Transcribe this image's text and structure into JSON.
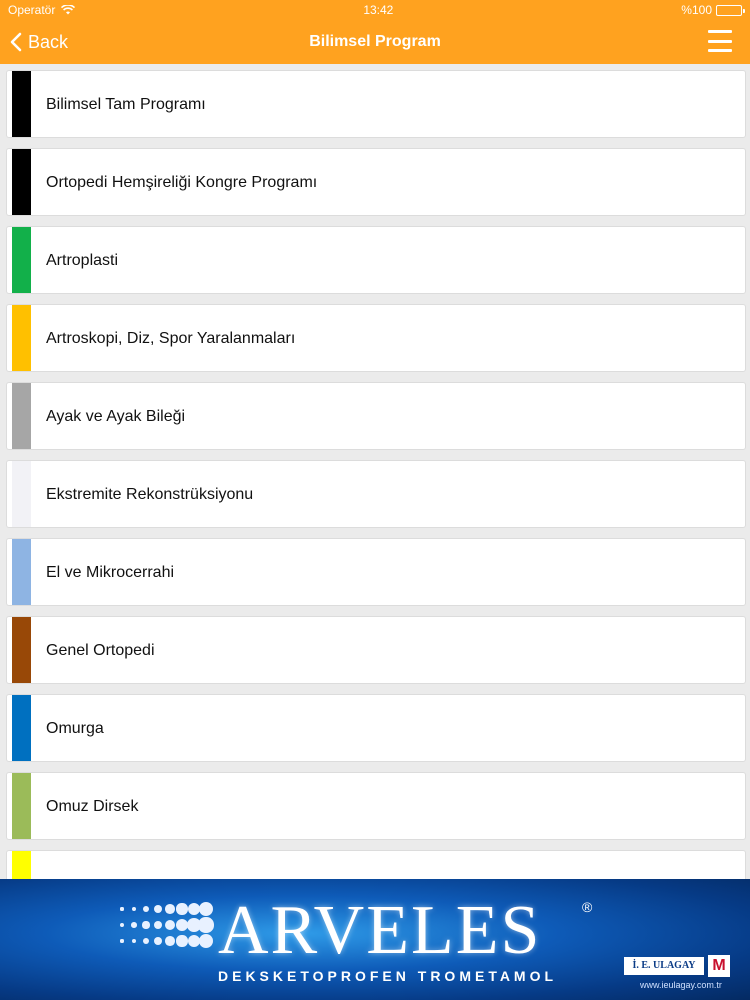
{
  "status": {
    "carrier": "Operatör",
    "time": "13:42",
    "battery": "%100",
    "battery_level": 1.0
  },
  "nav": {
    "back_label": "Back",
    "title": "Bilimsel Program"
  },
  "items": [
    {
      "label": "Bilimsel Tam Programı",
      "color": "#000000"
    },
    {
      "label": "Ortopedi Hemşireliği Kongre Programı",
      "color": "#000000"
    },
    {
      "label": "Artroplasti",
      "color": "#12b04a"
    },
    {
      "label": "Artroskopi, Diz, Spor Yaralanmaları",
      "color": "#ffc000"
    },
    {
      "label": "Ayak ve Ayak Bileği",
      "color": "#a6a6a6"
    },
    {
      "label": "Ekstremite Rekonstrüksiyonu",
      "color": "#f2f2f6"
    },
    {
      "label": "El ve Mikrocerrahi",
      "color": "#8eb4e3"
    },
    {
      "label": "Genel Ortopedi",
      "color": "#984807"
    },
    {
      "label": "Omurga",
      "color": "#0070c0"
    },
    {
      "label": "Omuz Dirsek",
      "color": "#9bbb59"
    },
    {
      "label": "",
      "color": "#ffff00"
    }
  ],
  "banner": {
    "brand": "ARVELES",
    "registered": "®",
    "tagline": "DEKSKETOPROFEN TROMETAMOL",
    "company": "İ. E. ULAGAY",
    "company_mark": "M",
    "website": "www.ieulagay.com.tr"
  },
  "colors": {
    "accent": "#ffa21f"
  }
}
